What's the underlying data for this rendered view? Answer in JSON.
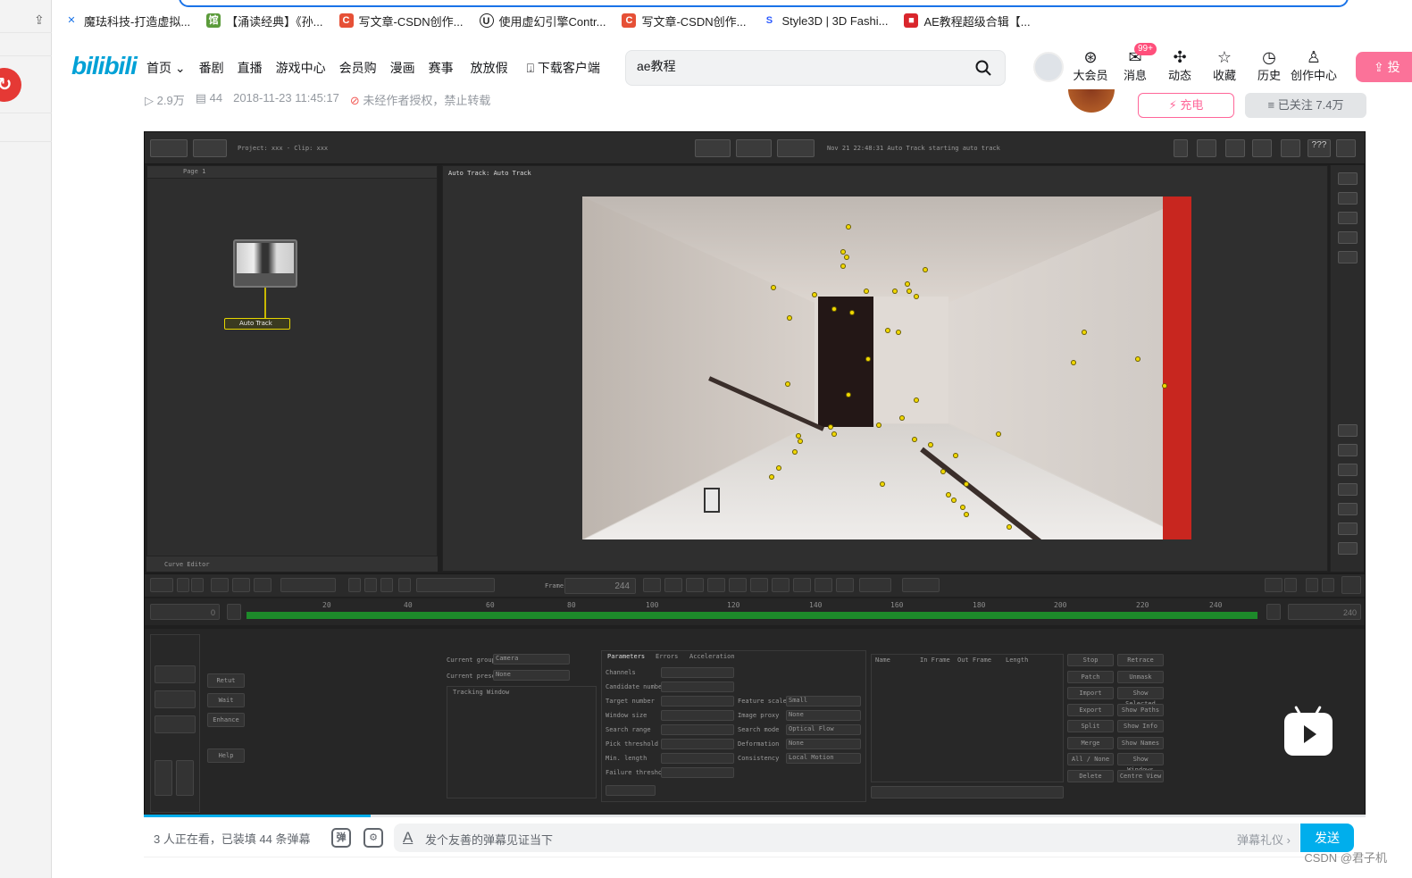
{
  "bookmarks": [
    {
      "label": "魔珐科技-打造虚拟...",
      "icon": "x-icon",
      "color": "#1a73e8"
    },
    {
      "label": "【涌读经典】《孙...",
      "icon": "book-icon",
      "color": "#5b9b3a"
    },
    {
      "label": "写文章-CSDN创作...",
      "icon": "csdn-icon",
      "color": "#e65036"
    },
    {
      "label": "使用虚幻引擎Contr...",
      "icon": "unreal-icon",
      "color": "#222222"
    },
    {
      "label": "写文章-CSDN创作...",
      "icon": "csdn-icon",
      "color": "#e65036"
    },
    {
      "label": "Style3D | 3D Fashi...",
      "icon": "style3d-icon",
      "color": "#2d5bff"
    },
    {
      "label": "AE教程超级合辑【...",
      "icon": "bookmark-red-icon",
      "color": "#d9262c"
    }
  ],
  "nav": {
    "logo": "bilibili",
    "links": [
      "首页",
      "番剧",
      "直播",
      "游戏中心",
      "会员购",
      "漫画",
      "赛事",
      "放放假",
      "下载客户端"
    ],
    "search_value": "ae教程",
    "icons": [
      {
        "label": "大会员",
        "glyph": "⊛"
      },
      {
        "label": "消息",
        "glyph": "✉",
        "badge": "99+"
      },
      {
        "label": "动态",
        "glyph": "✣"
      },
      {
        "label": "收藏",
        "glyph": "☆"
      },
      {
        "label": "历史",
        "glyph": "◷"
      },
      {
        "label": "创作中心",
        "glyph": "♙"
      }
    ],
    "upload_label": "投"
  },
  "meta": {
    "plays": "2.9万",
    "danmaku_count": "44",
    "datetime": "2018-11-23 11:45:17",
    "copyright": "未经作者授权，禁止转载"
  },
  "up": {
    "charge_label": "充电",
    "follow_label": "已关注 7.4万"
  },
  "software": {
    "project_label": "Project: xxx - Clip: xxx",
    "status_text": "Nov 21 22:48:31 Auto Track starting auto track",
    "page_tab": "Page 1",
    "node_label": "Auto Track",
    "viewer_label": "Auto Track: Auto Track",
    "help_label": "???",
    "frame_label": "Frame",
    "frame_value": "244",
    "curve_editor": "Curve Editor",
    "ruler_start": "0",
    "ruler_end": "240",
    "ruler_ticks": [
      "20",
      "40",
      "60",
      "80",
      "100",
      "120",
      "140",
      "160",
      "180",
      "200",
      "220",
      "240"
    ],
    "param_tabs": [
      "Parameters",
      "Errors",
      "Acceleration"
    ],
    "params": [
      "Channels",
      "Candidate number",
      "Target number",
      "Window size",
      "Search range",
      "Pick threshold %",
      "Min. length",
      "Failure threshold"
    ],
    "params2": [
      "Feature scale",
      "Image proxy",
      "Search mode",
      "Deformation",
      "Consistency"
    ],
    "param_values": [
      "Small",
      "None",
      "Optical Flow",
      "None",
      "Local Motion"
    ],
    "list_headers": [
      "Name",
      "In Frame",
      "Out Frame",
      "Length"
    ],
    "right_buttons": [
      "Stop",
      "Patch",
      "Import",
      "Export",
      "Split",
      "Merge",
      "All / None",
      "Delete"
    ],
    "right_buttons2": [
      "Retrace",
      "Unmask",
      "Show Selected",
      "Show Paths",
      "Show Info",
      "Show Names",
      "Show Windows",
      "Centre View"
    ],
    "left_buttons": [
      "Retut",
      "Wait",
      "Enhance",
      "Help"
    ],
    "group_label": "Current group",
    "group_value": "Camera",
    "preset_label": "Current preset",
    "preset_value": "None",
    "window_label": "Tracking Window"
  },
  "danmaku": {
    "viewers": "3 人正在看，已装填 44 条弹幕",
    "placeholder": "发个友善的弹幕见证当下",
    "etiquette": "弹幕礼仪 ›",
    "send": "发送"
  },
  "watermark": "CSDN @君子机",
  "progress_fraction": 0.186
}
